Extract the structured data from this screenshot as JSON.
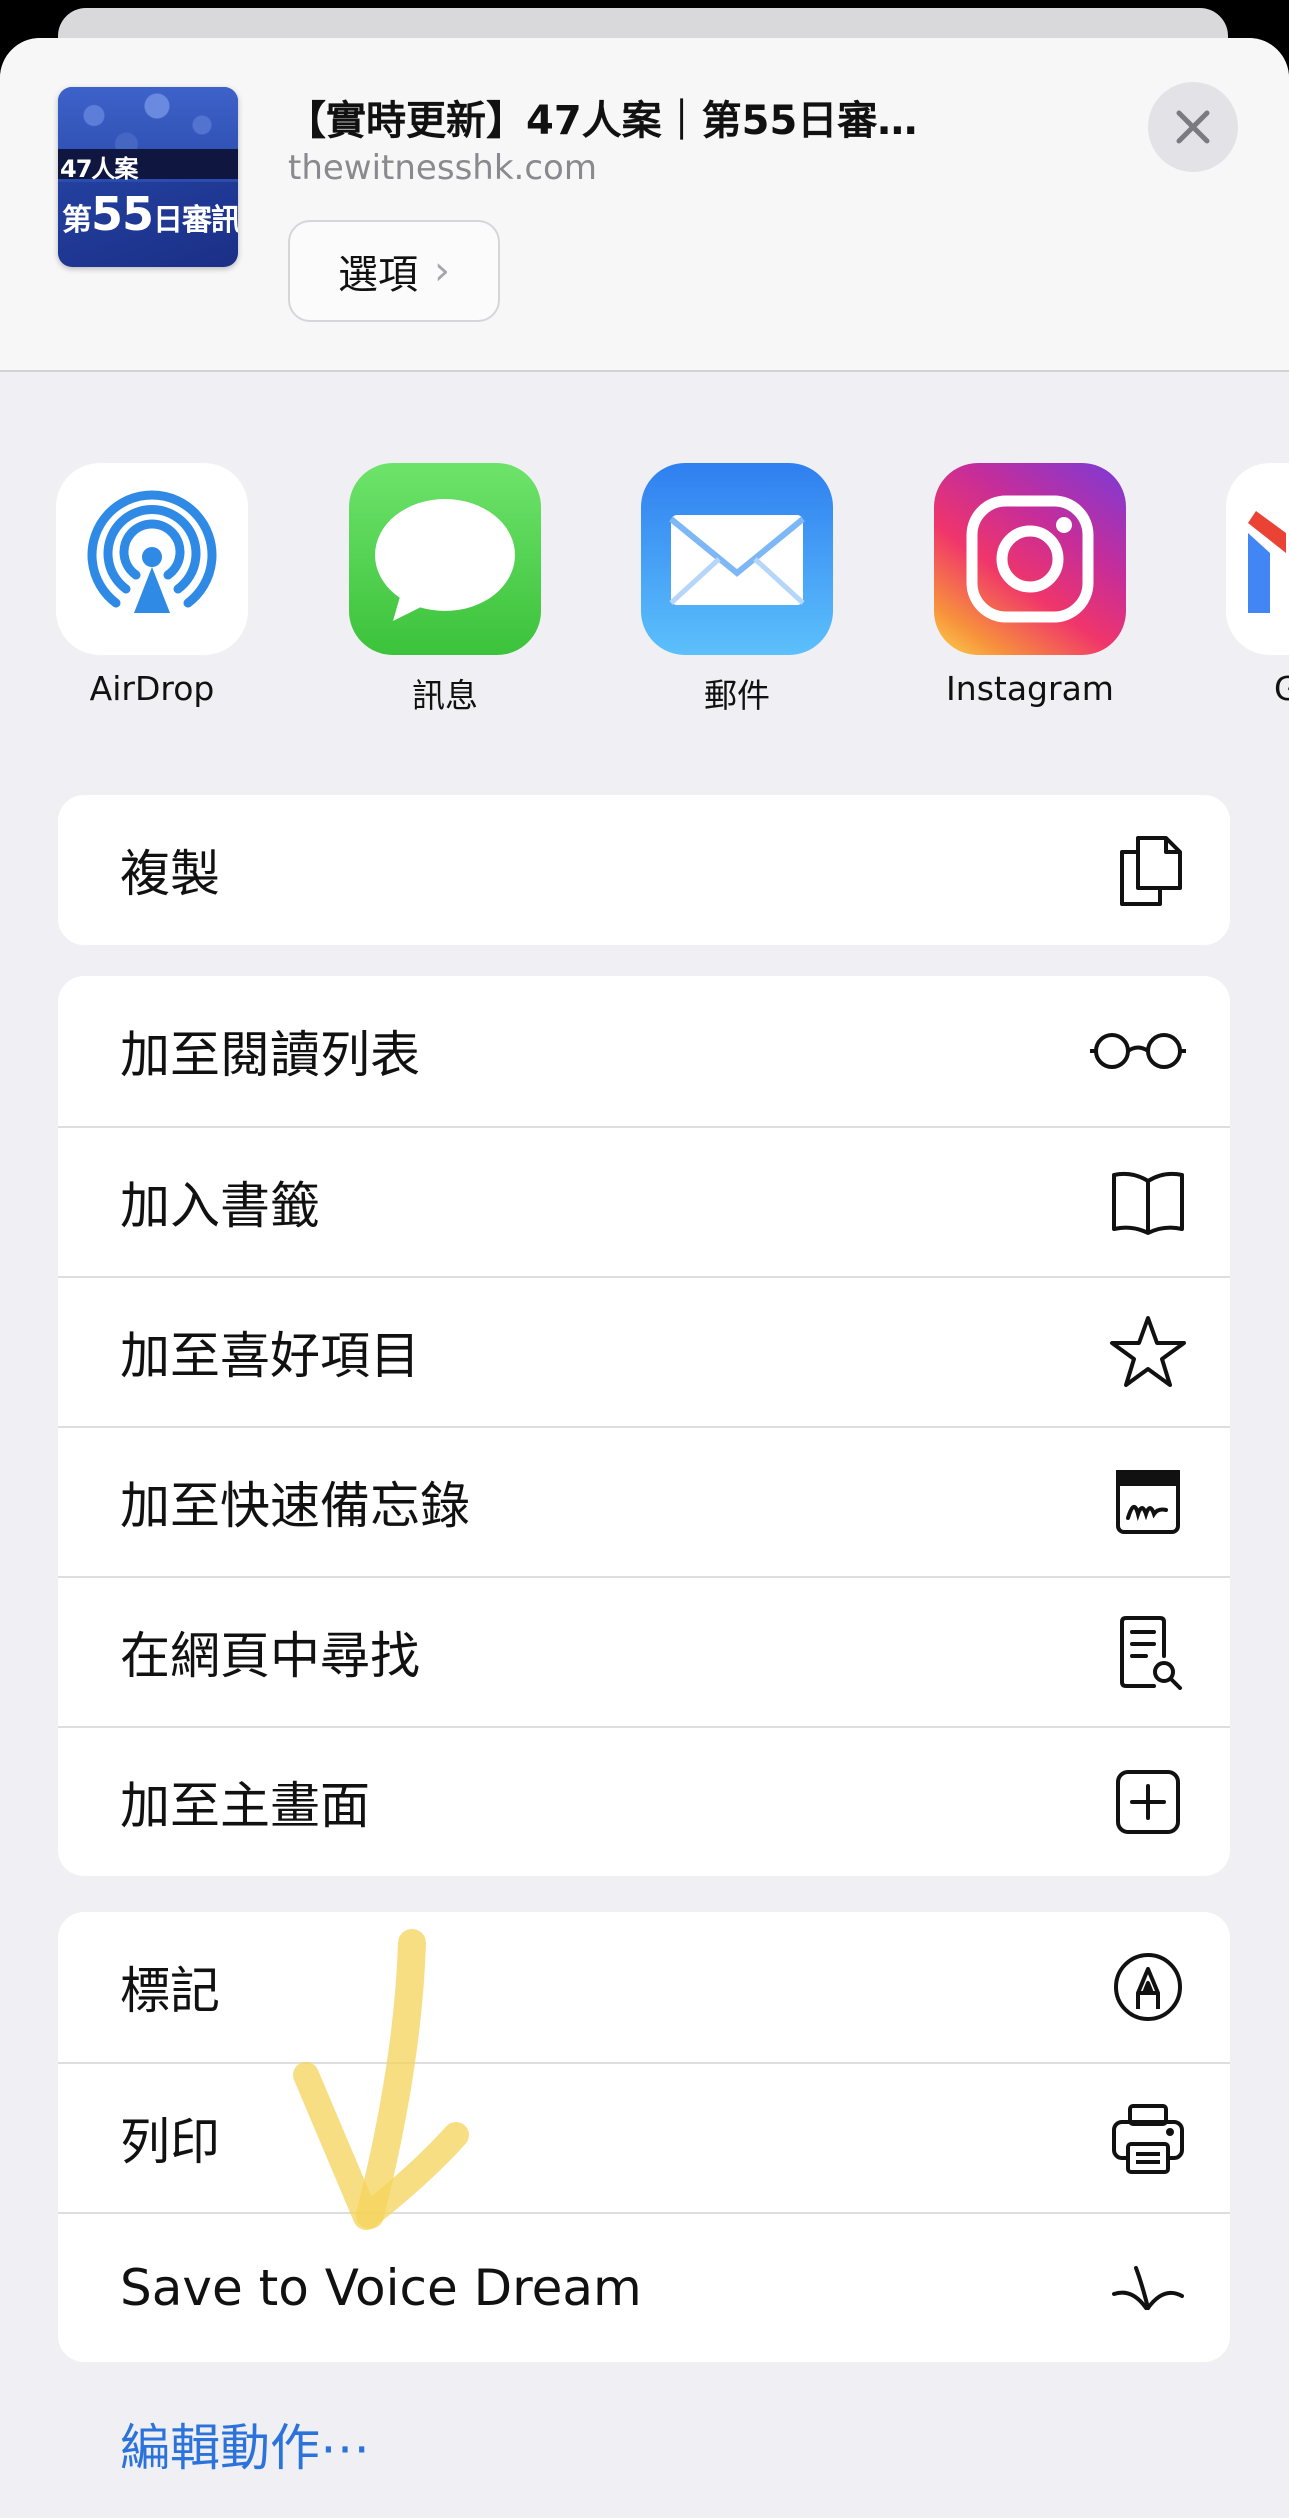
{
  "header": {
    "title": "【實時更新】47人案｜第55日審…",
    "domain": "thewitnesshk.com",
    "options_label": "選項",
    "thumbnail": {
      "line1": "47人案",
      "line2_prefix": "第",
      "line2_number": "55",
      "line2_suffix": "日審訊"
    }
  },
  "apps": [
    {
      "label": "AirDrop",
      "icon": "airdrop-icon"
    },
    {
      "label": "訊息",
      "icon": "messages-icon"
    },
    {
      "label": "郵件",
      "icon": "mail-icon"
    },
    {
      "label": "Instagram",
      "icon": "instagram-icon"
    },
    {
      "label": "G",
      "icon": "gmail-icon"
    }
  ],
  "group1": [
    {
      "label": "複製",
      "icon": "copy-icon"
    }
  ],
  "group2": [
    {
      "label": "加至閱讀列表",
      "icon": "glasses-icon"
    },
    {
      "label": "加入書籤",
      "icon": "book-icon"
    },
    {
      "label": "加至喜好項目",
      "icon": "star-icon"
    },
    {
      "label": "加至快速備忘錄",
      "icon": "quick-note-icon"
    },
    {
      "label": "在網頁中尋找",
      "icon": "find-on-page-icon"
    },
    {
      "label": "加至主畫面",
      "icon": "add-square-icon"
    }
  ],
  "group3": [
    {
      "label": "標記",
      "icon": "markup-icon"
    },
    {
      "label": "列印",
      "icon": "printer-icon"
    },
    {
      "label": "Save to Voice Dream",
      "icon": "voice-dream-icon"
    }
  ],
  "edit_actions_label": "編輯動作⋯",
  "colors": {
    "sheet_bg": "#f0f0f4",
    "link_blue": "#2b73da",
    "annotation_yellow": "#f6d35a"
  }
}
